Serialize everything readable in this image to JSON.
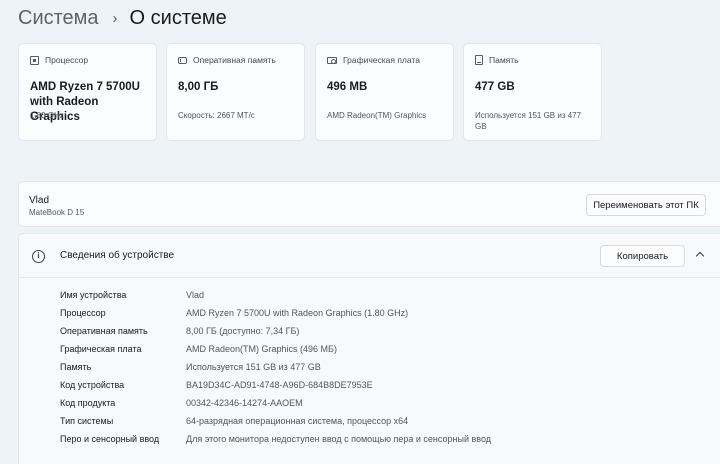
{
  "breadcrumb": {
    "parent": "Система",
    "separator": "›",
    "current": "О системе"
  },
  "cards": [
    {
      "icon": "cpu-icon",
      "title": "Процессор",
      "value": "AMD Ryzen 7 5700U with Radeon Graphics",
      "sub": "1,80 GHz"
    },
    {
      "icon": "ram-icon",
      "title": "Оперативная память",
      "value": "8,00 ГБ",
      "sub": "Скорость: 2667 МТ/с"
    },
    {
      "icon": "gpu-icon",
      "title": "Графическая плата",
      "value": "496 MB",
      "sub": "AMD Radeon(TM) Graphics"
    },
    {
      "icon": "storage-icon",
      "title": "Память",
      "value": "477 GB",
      "sub": "Используется 151 GB из 477 GB"
    }
  ],
  "device": {
    "name": "Vlad",
    "model": "MateBook D 15",
    "rename_label": "Переименовать этот ПК"
  },
  "specs": {
    "title": "Сведения об устройстве",
    "copy_label": "Копировать",
    "rows": [
      {
        "label": "Имя устройства",
        "value": "Vlad"
      },
      {
        "label": "Процессор",
        "value": "AMD Ryzen 7 5700U with Radeon Graphics (1.80 GHz)"
      },
      {
        "label": "Оперативная память",
        "value": "8,00 ГБ (доступно: 7,34 ГБ)"
      },
      {
        "label": "Графическая плата",
        "value": "AMD Radeon(TM) Graphics (496 МБ)"
      },
      {
        "label": "Память",
        "value": "Используется 151 GB из 477 GB"
      },
      {
        "label": "Код устройства",
        "value": "BA19D34C-AD91-4748-A96D-684B8DE7953E"
      },
      {
        "label": "Код продукта",
        "value": "00342-42346-14274-AAOEM"
      },
      {
        "label": "Тип системы",
        "value": "64-разрядная операционная система, процессор x64"
      },
      {
        "label": "Перо и сенсорный ввод",
        "value": "Для этого монитора недоступен ввод с помощью пера и сенсорный ввод"
      }
    ]
  }
}
